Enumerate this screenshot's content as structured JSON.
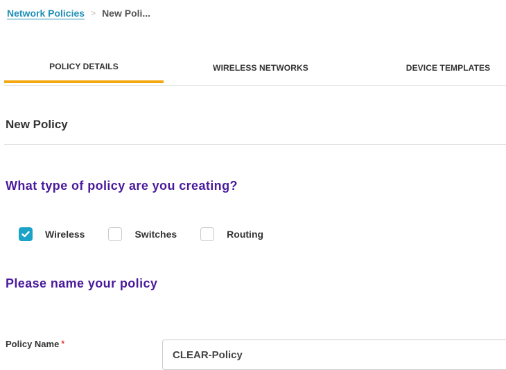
{
  "breadcrumb": {
    "parent": "Network Policies",
    "separator": ">",
    "current": "New Poli..."
  },
  "tabs": [
    {
      "label": "POLICY DETAILS",
      "active": true
    },
    {
      "label": "WIRELESS NETWORKS",
      "active": false
    },
    {
      "label": "DEVICE TEMPLATES",
      "active": false
    }
  ],
  "section": {
    "title": "New Policy"
  },
  "policy_type": {
    "question": "What type of policy are you creating?",
    "options": [
      {
        "label": "Wireless",
        "checked": true
      },
      {
        "label": "Switches",
        "checked": false
      },
      {
        "label": "Routing",
        "checked": false
      }
    ]
  },
  "naming": {
    "question": "Please name your policy",
    "field_label": "Policy Name",
    "required_marker": "*",
    "value": "CLEAR-Policy"
  },
  "colors": {
    "accent_tab": "#f3a712",
    "link": "#1f8fb5",
    "heading_purple": "#4a1a9c",
    "checkbox_checked": "#1aa3c6",
    "required": "#d9362b"
  }
}
